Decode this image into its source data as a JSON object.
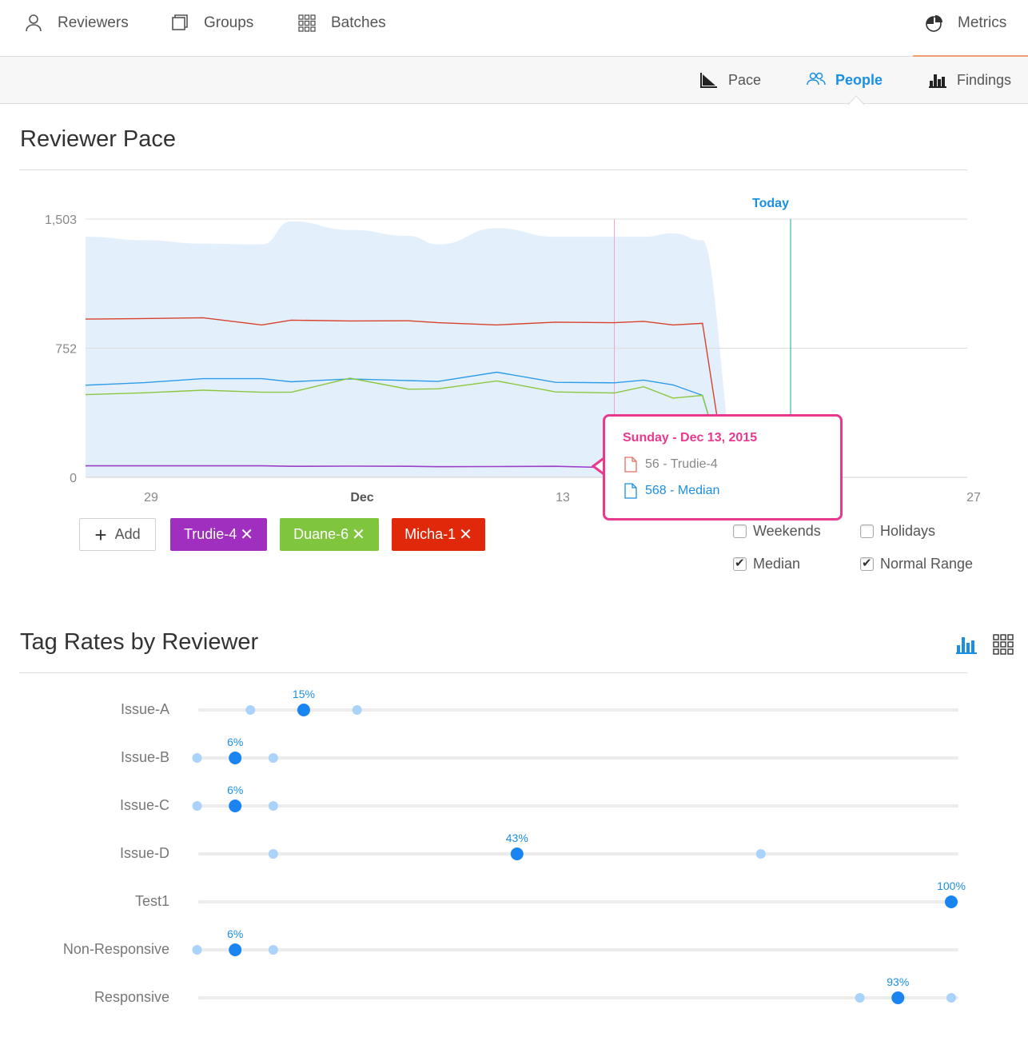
{
  "topnav": {
    "items": [
      {
        "label": "Reviewers",
        "icon": "person-icon"
      },
      {
        "label": "Groups",
        "icon": "square-icon"
      },
      {
        "label": "Batches",
        "icon": "grid-icon"
      },
      {
        "label": "Metrics",
        "icon": "pie-icon"
      }
    ],
    "accent": "#f0a070"
  },
  "subnav": {
    "items": [
      {
        "label": "Pace",
        "icon": "pace-icon"
      },
      {
        "label": "People",
        "icon": "people-icon",
        "active": true
      },
      {
        "label": "Findings",
        "icon": "bar-chart-icon"
      }
    ]
  },
  "pace": {
    "title": "Reviewer Pace",
    "today_label": "Today",
    "tooltip": {
      "title": "Sunday - Dec 13, 2015",
      "row1": "56 - Trudie-4",
      "row2": "568 - Median"
    },
    "add_label": "Add",
    "chips": [
      {
        "label": "Trudie-4",
        "color": "#a02fc0"
      },
      {
        "label": "Duane-6",
        "color": "#7fc63e"
      },
      {
        "label": "Micha-1",
        "color": "#e0280a"
      }
    ],
    "options": [
      {
        "label": "Weekends",
        "checked": false
      },
      {
        "label": "Holidays",
        "checked": false
      },
      {
        "label": "Median",
        "checked": true
      },
      {
        "label": "Normal Range",
        "checked": true
      }
    ]
  },
  "chart_data": {
    "type": "line",
    "y_ticks": [
      "1,503",
      "752",
      "0"
    ],
    "ylim": [
      0,
      1503
    ],
    "x_ticks": [
      "29",
      "Dec",
      "13",
      "27"
    ],
    "x": [
      "Nov 26",
      "Nov 28",
      "Nov 30",
      "Dec 1",
      "Dec 2",
      "Dec 4",
      "Dec 6",
      "Dec 7",
      "Dec 9",
      "Dec 11",
      "Dec 13",
      "Dec 14",
      "Dec 15",
      "Dec 16"
    ],
    "series": [
      {
        "name": "Micha-1",
        "color": "#d8412b",
        "values": [
          921,
          924,
          929,
          887,
          915,
          910,
          911,
          900,
          887,
          903,
          900,
          908,
          887,
          896
        ]
      },
      {
        "name": "Median",
        "color": "#2d9be8",
        "values": [
          536,
          551,
          574,
          574,
          556,
          573,
          563,
          558,
          612,
          553,
          550,
          566,
          538,
          477
        ]
      },
      {
        "name": "Duane-6",
        "color": "#8cc63f",
        "values": [
          481,
          492,
          507,
          495,
          495,
          577,
          513,
          515,
          561,
          497,
          491,
          527,
          461,
          477
        ]
      },
      {
        "name": "Trudie-4",
        "color": "#9b3fc7",
        "values": [
          67,
          67,
          67,
          67,
          64,
          65,
          64,
          62,
          63,
          64,
          56,
          56,
          56,
          56
        ]
      }
    ],
    "normal_range_max": [
      1400,
      1380,
      1360,
      1355,
      1490,
      1440,
      1405,
      1355,
      1450,
      1400,
      1400,
      1400,
      1420,
      1380
    ],
    "highlight": {
      "date": "Dec 13, 2015",
      "value": 56,
      "series": "Trudie-4"
    },
    "today_x": "Dec 19",
    "x_end": "Dec 27"
  },
  "tags": {
    "title": "Tag Rates by Reviewer",
    "view_icons": [
      "bar-chart-icon",
      "grid-icon"
    ],
    "rows": [
      {
        "label": "Issue-A",
        "value": 15,
        "label_text": "15%",
        "range": [
          8,
          22
        ]
      },
      {
        "label": "Issue-B",
        "value": 6,
        "label_text": "6%",
        "range": [
          1,
          11
        ]
      },
      {
        "label": "Issue-C",
        "value": 6,
        "label_text": "6%",
        "range": [
          1,
          11
        ]
      },
      {
        "label": "Issue-D",
        "value": 43,
        "label_text": "43%",
        "range": [
          11,
          75
        ]
      },
      {
        "label": "Test1",
        "value": 100,
        "label_text": "100%",
        "range": [
          100,
          100
        ]
      },
      {
        "label": "Non-Responsive",
        "value": 6,
        "label_text": "6%",
        "range": [
          1,
          11
        ]
      },
      {
        "label": "Responsive",
        "value": 93,
        "label_text": "93%",
        "range": [
          88,
          100
        ]
      }
    ]
  }
}
